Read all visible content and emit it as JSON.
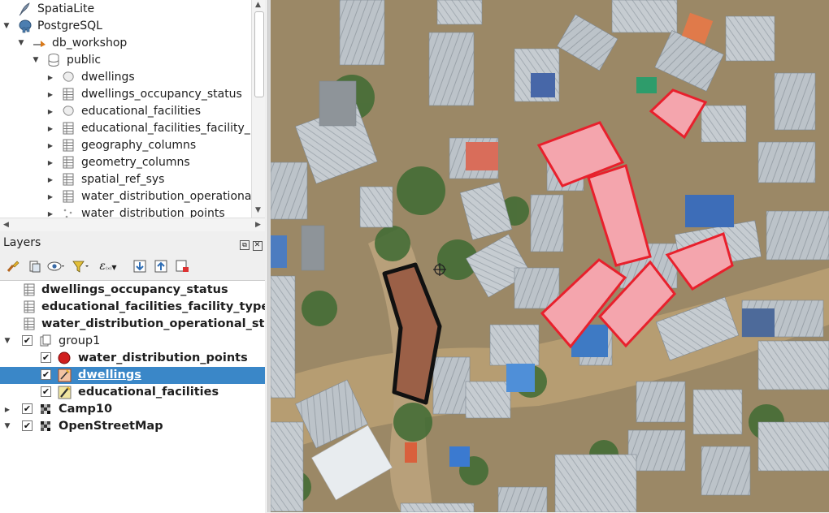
{
  "browser": {
    "items": [
      {
        "label": "SpatiaLite",
        "icon": "feather-icon"
      },
      {
        "label": "PostgreSQL",
        "icon": "elephant-icon"
      },
      {
        "label": "db_workshop",
        "icon": "connection-icon"
      },
      {
        "label": "public",
        "icon": "schema-icon"
      },
      {
        "label": "dwellings",
        "icon": "polygon-table-icon"
      },
      {
        "label": "dwellings_occupancy_status",
        "icon": "table-icon"
      },
      {
        "label": "educational_facilities",
        "icon": "polygon-table-icon"
      },
      {
        "label": "educational_facilities_facility_",
        "icon": "table-icon"
      },
      {
        "label": "geography_columns",
        "icon": "table-icon"
      },
      {
        "label": "geometry_columns",
        "icon": "table-icon"
      },
      {
        "label": "spatial_ref_sys",
        "icon": "table-icon"
      },
      {
        "label": "water_distribution_operationa",
        "icon": "table-icon"
      },
      {
        "label": "water_distribution_points",
        "icon": "point-table-icon"
      }
    ]
  },
  "layers_panel": {
    "title": "Layers",
    "items": [
      {
        "label": "dwellings_occupancy_status",
        "checked": false,
        "icon": "table-icon"
      },
      {
        "label": "educational_facilities_facility_type",
        "checked": false,
        "icon": "table-icon"
      },
      {
        "label": "water_distribution_operational_sta",
        "checked": false,
        "icon": "table-icon"
      },
      {
        "label": "group1",
        "checked": true,
        "icon": "group-icon"
      },
      {
        "label": "water_distribution_points",
        "checked": true,
        "icon": "red-point-icon"
      },
      {
        "label": "dwellings",
        "checked": true,
        "icon": "edit-polygon-icon",
        "selected": true
      },
      {
        "label": "educational_facilities",
        "checked": true,
        "icon": "pencil-icon"
      },
      {
        "label": "Camp10",
        "checked": true,
        "icon": "raster-icon"
      },
      {
        "label": "OpenStreetMap",
        "checked": true,
        "icon": "raster-icon"
      }
    ]
  },
  "colors": {
    "selection": "#3a87c8",
    "educational_fill": "#f4a5ad",
    "educational_stroke": "#e8202c",
    "dwelling_fill": "#9b6047",
    "dwelling_stroke": "#111111"
  }
}
